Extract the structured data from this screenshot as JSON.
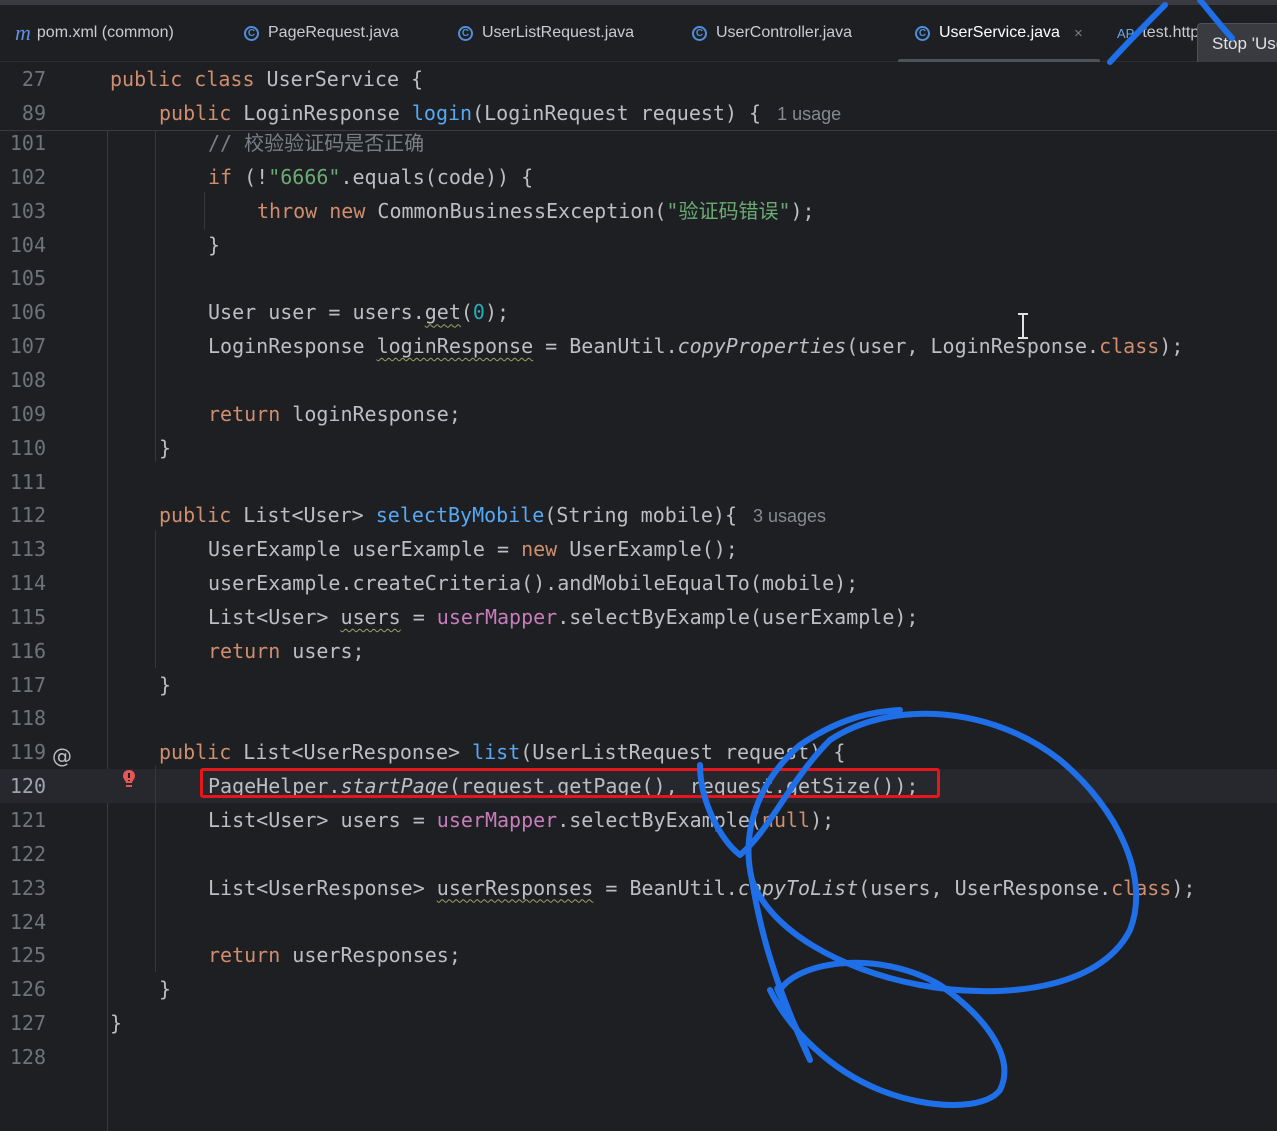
{
  "tabs": [
    {
      "name": "pom.xml",
      "label": "pom.xml (common)",
      "icon": "maven-icon",
      "active": false
    },
    {
      "name": "pagerequest",
      "label": "PageRequest.java",
      "icon": "class-icon",
      "active": false
    },
    {
      "name": "userlistrequest",
      "label": "UserListRequest.java",
      "icon": "class-icon",
      "active": false
    },
    {
      "name": "usercontroller",
      "label": "UserController.java",
      "icon": "class-icon",
      "active": false
    },
    {
      "name": "userservice",
      "label": "UserService.java",
      "icon": "class-icon",
      "active": true
    },
    {
      "name": "test-http",
      "label": "test.http",
      "icon": "http-file-icon",
      "active": false
    }
  ],
  "tab_close_glyph": "×",
  "tooltip": "Stop 'UserApplication'",
  "editor": {
    "current_line": "120",
    "lines": [
      {
        "n": "27",
        "sticky": true,
        "tokens": [
          [
            "kw",
            "public class "
          ],
          [
            "",
            "UserService {"
          ]
        ]
      },
      {
        "n": "89",
        "sticky": true,
        "tokens": [
          [
            "kw",
            "public "
          ],
          [
            "",
            "LoginResponse "
          ],
          [
            "fn",
            "login"
          ],
          [
            "",
            "(LoginRequest request) {"
          ]
        ],
        "hint": "1 usage"
      },
      {
        "n": "101",
        "tokens": [
          [
            "cmt",
            "// 校验验证码是否正确"
          ]
        ]
      },
      {
        "n": "102",
        "tokens": [
          [
            "kw",
            "if "
          ],
          [
            "",
            "(!"
          ],
          [
            "str",
            "\"6666\""
          ],
          [
            "",
            ".equals(code)) {"
          ]
        ]
      },
      {
        "n": "103",
        "tokens": [
          [
            "kw",
            "throw new "
          ],
          [
            "",
            "CommonBusinessException("
          ],
          [
            "str",
            "\"验证码错误\""
          ],
          [
            "",
            ");"
          ]
        ]
      },
      {
        "n": "104",
        "tokens": [
          [
            "",
            "}"
          ]
        ]
      },
      {
        "n": "105",
        "tokens": []
      },
      {
        "n": "106",
        "tokens": [
          [
            "",
            "User user = users."
          ],
          [
            "warn",
            "get"
          ],
          [
            "",
            "("
          ],
          [
            "num",
            "0"
          ],
          [
            "",
            ");"
          ]
        ]
      },
      {
        "n": "107",
        "tokens": [
          [
            "",
            "LoginResponse "
          ],
          [
            "warn",
            "loginResponse"
          ],
          [
            "",
            " = BeanUtil."
          ],
          [
            "it",
            "copyProperties"
          ],
          [
            "",
            "(user, LoginResponse."
          ],
          [
            "kw",
            "class"
          ],
          [
            "",
            ");"
          ]
        ]
      },
      {
        "n": "108",
        "tokens": []
      },
      {
        "n": "109",
        "tokens": [
          [
            "kw",
            "return "
          ],
          [
            "",
            "loginResponse;"
          ]
        ]
      },
      {
        "n": "110",
        "tokens": [
          [
            "",
            "}"
          ]
        ]
      },
      {
        "n": "111",
        "tokens": []
      },
      {
        "n": "112",
        "tokens": [
          [
            "kw",
            "public "
          ],
          [
            "",
            "List<User> "
          ],
          [
            "fn",
            "selectByMobile"
          ],
          [
            "",
            "(String mobile){"
          ]
        ],
        "hint": "3 usages"
      },
      {
        "n": "113",
        "tokens": [
          [
            "",
            "UserExample userExample = "
          ],
          [
            "kw",
            "new "
          ],
          [
            "",
            "UserExample();"
          ]
        ]
      },
      {
        "n": "114",
        "tokens": [
          [
            "",
            "userExample.createCriteria().andMobileEqualTo(mobile);"
          ]
        ]
      },
      {
        "n": "115",
        "tokens": [
          [
            "",
            "List<User> "
          ],
          [
            "warn",
            "users"
          ],
          [
            "",
            " = "
          ],
          [
            "fld",
            "userMapper"
          ],
          [
            "",
            ".selectByExample(userExample);"
          ]
        ]
      },
      {
        "n": "116",
        "tokens": [
          [
            "kw",
            "return "
          ],
          [
            "",
            "users;"
          ]
        ]
      },
      {
        "n": "117",
        "tokens": [
          [
            "",
            "}"
          ]
        ]
      },
      {
        "n": "118",
        "tokens": []
      },
      {
        "n": "119",
        "tokens": [
          [
            "kw",
            "public "
          ],
          [
            "",
            "List<UserResponse> "
          ],
          [
            "fn",
            "list"
          ],
          [
            "",
            "(UserListRequest request) {"
          ]
        ]
      },
      {
        "n": "120",
        "tokens": [
          [
            "",
            "PageHelper."
          ],
          [
            "it",
            "startPage"
          ],
          [
            "",
            "(request.getPage(), request.getSize());"
          ]
        ]
      },
      {
        "n": "121",
        "tokens": [
          [
            "",
            "List<User> users = "
          ],
          [
            "fld",
            "userMapper"
          ],
          [
            "",
            ".selectByExample("
          ],
          [
            "kw",
            "null"
          ],
          [
            "",
            ");"
          ]
        ]
      },
      {
        "n": "122",
        "tokens": []
      },
      {
        "n": "123",
        "tokens": [
          [
            "",
            "List<UserResponse> "
          ],
          [
            "warn",
            "userResponses"
          ],
          [
            "",
            " = BeanUtil."
          ],
          [
            "it",
            "copyToList"
          ],
          [
            "",
            "(users, UserResponse."
          ],
          [
            "kw",
            "class"
          ],
          [
            "",
            ");"
          ]
        ]
      },
      {
        "n": "124",
        "tokens": []
      },
      {
        "n": "125",
        "tokens": [
          [
            "kw",
            "return "
          ],
          [
            "",
            "userResponses;"
          ]
        ]
      },
      {
        "n": "126",
        "tokens": [
          [
            "",
            "}"
          ]
        ]
      },
      {
        "n": "127",
        "tokens": [
          [
            "",
            "}"
          ]
        ]
      },
      {
        "n": "128",
        "tokens": []
      }
    ]
  },
  "gutter_icons": {
    "override": "@",
    "error_bulb": "bulb-icon"
  },
  "colors": {
    "background": "#1e1f22",
    "keyword": "#cf8e6d",
    "function": "#56a8f5",
    "string": "#6aab73",
    "number": "#2aacb8",
    "field": "#c77dbb",
    "comment": "#7a7e85",
    "annotation_box": "#e8151b",
    "annotation_scribble": "#1f6fe8"
  }
}
